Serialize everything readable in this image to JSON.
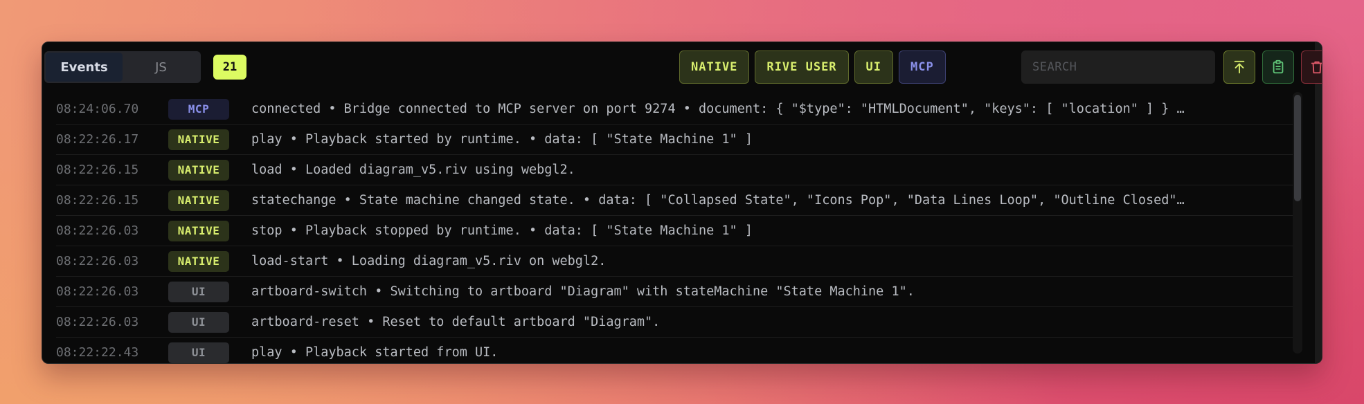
{
  "tabs": [
    {
      "label": "Events",
      "active": true
    },
    {
      "label": "JS",
      "active": false
    }
  ],
  "event_count": "21",
  "filters": {
    "native": "NATIVE",
    "rive_user": "RIVE USER",
    "ui": "UI",
    "mcp": "MCP"
  },
  "search": {
    "placeholder": "SEARCH",
    "value": ""
  },
  "actions": {
    "scroll_top_icon": "arrow-up-to-line-icon",
    "copy_icon": "clipboard-icon",
    "clear_icon": "trash-icon"
  },
  "colors": {
    "native_fg": "#d9ef6e",
    "mcp_fg": "#8a90ea",
    "ui_fg": "#8d9096",
    "count_bg": "#dcfb62"
  },
  "events": [
    {
      "time": "08:24:06.70",
      "source": "MCP",
      "message": "connected • Bridge connected to MCP server on port 9274 • document: { \"$type\": \"HTMLDocument\", \"keys\": [ \"location\" ] } …"
    },
    {
      "time": "08:22:26.17",
      "source": "NATIVE",
      "message": "play • Playback started by runtime. • data: [ \"State Machine 1\" ]"
    },
    {
      "time": "08:22:26.15",
      "source": "NATIVE",
      "message": "load • Loaded diagram_v5.riv using webgl2."
    },
    {
      "time": "08:22:26.15",
      "source": "NATIVE",
      "message": "statechange • State machine changed state. • data: [ \"Collapsed State\", \"Icons Pop\", \"Data Lines Loop\", \"Outline Closed\"…"
    },
    {
      "time": "08:22:26.03",
      "source": "NATIVE",
      "message": "stop • Playback stopped by runtime. • data: [ \"State Machine 1\" ]"
    },
    {
      "time": "08:22:26.03",
      "source": "NATIVE",
      "message": "load-start • Loading diagram_v5.riv on webgl2."
    },
    {
      "time": "08:22:26.03",
      "source": "UI",
      "message": "artboard-switch • Switching to artboard \"Diagram\" with stateMachine \"State Machine 1\"."
    },
    {
      "time": "08:22:26.03",
      "source": "UI",
      "message": "artboard-reset • Reset to default artboard \"Diagram\"."
    },
    {
      "time": "08:22:22.43",
      "source": "UI",
      "message": "play • Playback started from UI."
    }
  ]
}
